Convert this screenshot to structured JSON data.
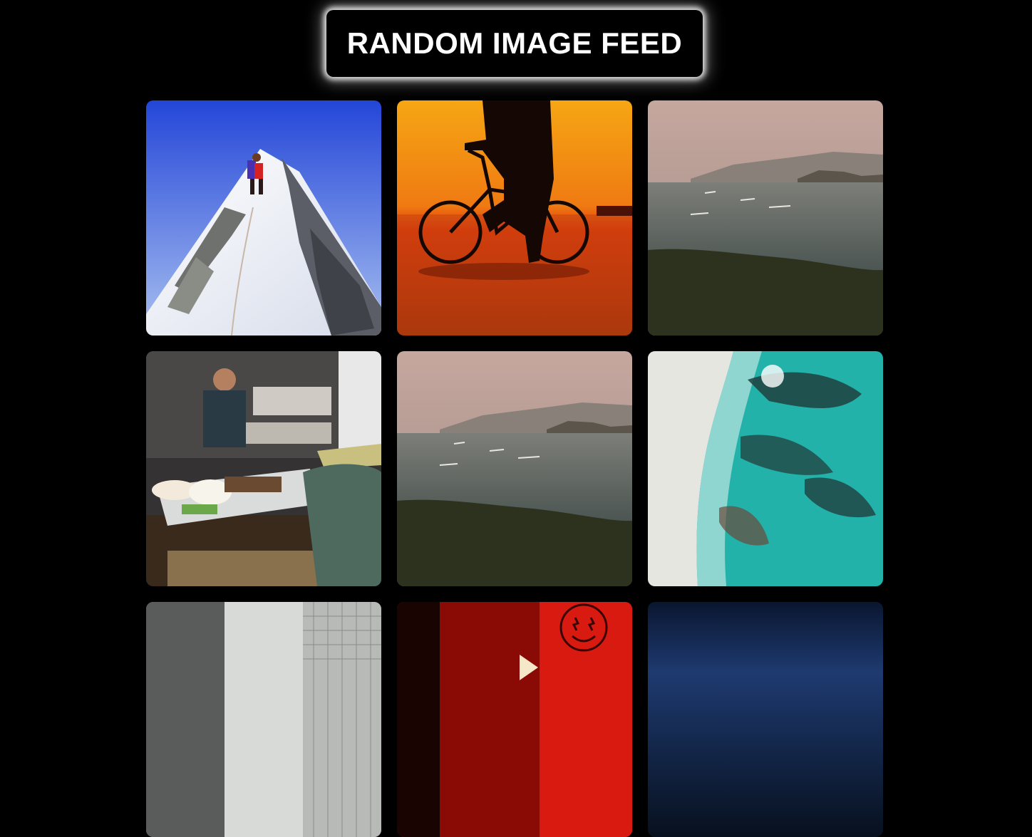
{
  "header": {
    "title": "RANDOM IMAGE FEED"
  },
  "feed": {
    "images": [
      {
        "subject": "mountain-climber-on-snowy-peak",
        "colors": [
          "#2a52d8",
          "#f2f5fb",
          "#5d6068"
        ]
      },
      {
        "subject": "cyclist-silhouette-at-sunset",
        "colors": [
          "#f39a12",
          "#d4460b",
          "#1a0a04"
        ]
      },
      {
        "subject": "misty-coastal-cliffs",
        "colors": [
          "#b89a90",
          "#555a55",
          "#2e3320"
        ]
      },
      {
        "subject": "street-food-tray",
        "colors": [
          "#3b3b3b",
          "#e8e0d0",
          "#4d6a5e"
        ]
      },
      {
        "subject": "misty-coastal-cliffs",
        "colors": [
          "#b89a90",
          "#555a55",
          "#2e3320"
        ]
      },
      {
        "subject": "aerial-turquoise-shoreline",
        "colors": [
          "#1fb3ac",
          "#e8e8e2",
          "#234a48"
        ]
      },
      {
        "subject": "tiled-hallway",
        "colors": [
          "#9a9c9c",
          "#d8dad8",
          "#4a4c4c"
        ]
      },
      {
        "subject": "red-neon-smiley-wall",
        "colors": [
          "#c8140a",
          "#7a0806",
          "#1a0202"
        ]
      },
      {
        "subject": "night-blue-sky",
        "colors": [
          "#0a1430",
          "#1f3a70",
          "#050a18"
        ]
      }
    ]
  }
}
